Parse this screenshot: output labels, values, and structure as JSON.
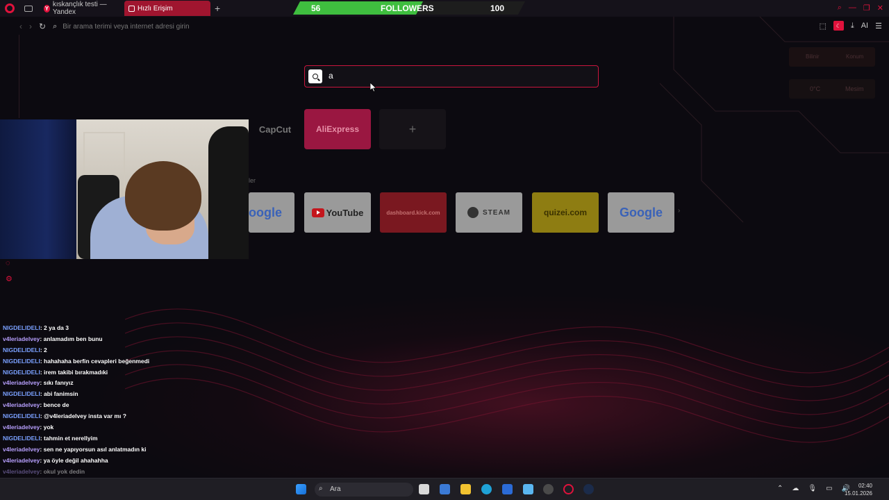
{
  "browser": {
    "tabs": [
      {
        "label": "kıskançlık testi — Yandex"
      },
      {
        "label": "Hızlı Erişim"
      }
    ],
    "address_placeholder": "Bir arama terimi veya internet adresi girin",
    "ai_label": "AI"
  },
  "followers_widget": {
    "current": "56",
    "label": "FOLLOWERS",
    "goal": "100",
    "progress_fraction": 0.56,
    "fill_color": "#3fbe3f"
  },
  "search": {
    "value": "a"
  },
  "speed_dial": {
    "top_row": [
      "CapCut",
      "AliExpress",
      "+"
    ],
    "section_label": "ler",
    "bottom_row": [
      "oogle",
      "YouTube",
      "dashboard.kick.com",
      "STEAM",
      "quizei.com",
      "Google"
    ]
  },
  "weather": {
    "city": "Bilinir",
    "loc": "Konum",
    "temp": "0°C",
    "cond": "Mesim"
  },
  "chat": [
    {
      "user": "NIGDELIDELI",
      "text": ": 2 ya da 3"
    },
    {
      "user": "v4leriadelvey",
      "text": ": anlamadım ben bunu"
    },
    {
      "user": "NIGDELIDELI",
      "text": ": 2"
    },
    {
      "user": "NIGDELIDELI",
      "text": ": hahahaha berfin cevapleri beğenmedi"
    },
    {
      "user": "NIGDELIDELI",
      "text": ": irem takibi bırakmadıki"
    },
    {
      "user": "v4leriadelvey",
      "text": ": sıkı fanıyız"
    },
    {
      "user": "NIGDELIDELI",
      "text": ": abi fanimsin"
    },
    {
      "user": "v4leriadelvey",
      "text": ": bence de"
    },
    {
      "user": "NIGDELIDELI",
      "text": ": @v4leriadelvey insta var mı ?"
    },
    {
      "user": "v4leriadelvey",
      "text": ": yok"
    },
    {
      "user": "NIGDELIDELI",
      "text": ": tahmin et nerellyim"
    },
    {
      "user": "v4leriadelvey",
      "text": ": sen ne yapıyorsun asıl anlatmadın ki"
    },
    {
      "user": "v4leriadelvey",
      "text": ": ya öyle değil ahahahha"
    },
    {
      "user": "v4leriadelvey",
      "text": ": okul yok dedin"
    }
  ],
  "taskbar": {
    "search_label": "Ara",
    "time": "02:40",
    "date": "15.01.2026"
  },
  "colors": {
    "accent": "#e0123c",
    "active_tab": "#a0152f",
    "search_border": "#c9163e"
  }
}
